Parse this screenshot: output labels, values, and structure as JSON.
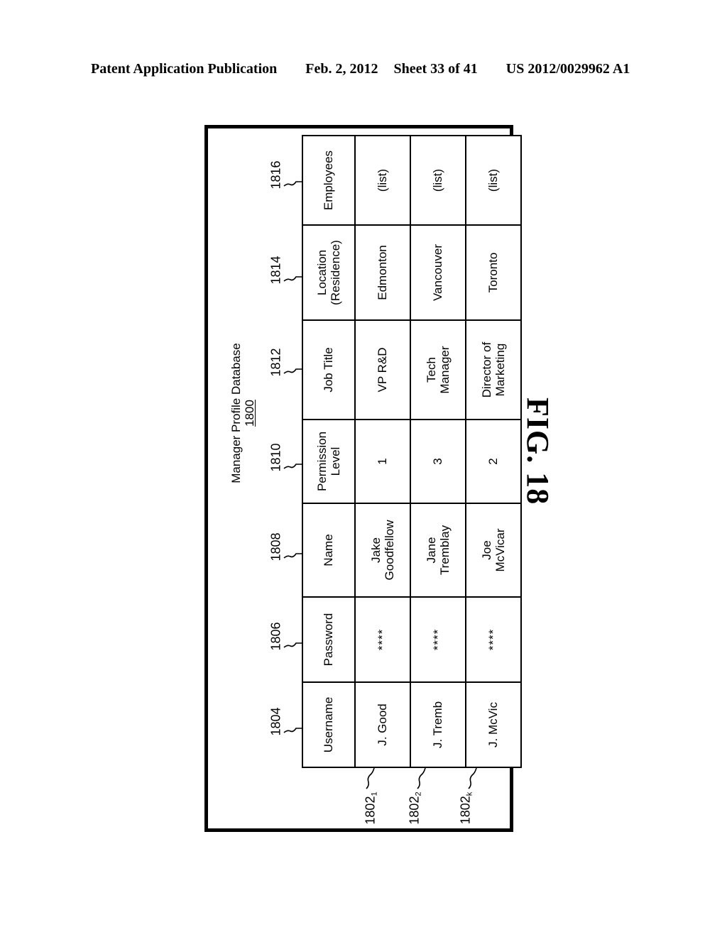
{
  "header": {
    "publication": "Patent Application Publication",
    "date": "Feb. 2, 2012",
    "sheet": "Sheet 33 of 41",
    "patent_number": "US 2012/0029962 A1"
  },
  "figure": {
    "label": "FIG. 18",
    "title": "Manager Profile Database",
    "title_ref": "1800"
  },
  "table": {
    "columns": [
      {
        "label": "Username",
        "ref": "1804"
      },
      {
        "label": "Password",
        "ref": "1806"
      },
      {
        "label": "Name",
        "ref": "1808"
      },
      {
        "label": "Permission\nLevel",
        "ref": "1810"
      },
      {
        "label": "Job Title",
        "ref": "1812"
      },
      {
        "label": "Location\n(Residence)",
        "ref": "1814"
      },
      {
        "label": "Employees",
        "ref": "1816"
      }
    ],
    "rows": [
      {
        "ref": "1802",
        "ref_sub": "1",
        "username": "J. Good",
        "password": "****",
        "name": "Jake\nGoodfellow",
        "permission_level": "1",
        "job_title": "VP R&D",
        "location": "Edmonton",
        "employees": "(list)"
      },
      {
        "ref": "1802",
        "ref_sub": "2",
        "username": "J. Tremb",
        "password": "****",
        "name": "Jane\nTremblay",
        "permission_level": "3",
        "job_title": "Tech\nManager",
        "location": "Vancouver",
        "employees": "(list)"
      },
      {
        "ref": "1802",
        "ref_sub": "k",
        "username": "J. McVic",
        "password": "****",
        "name": "Joe\nMcVicar",
        "permission_level": "2",
        "job_title": "Director of\nMarketing",
        "location": "Toronto",
        "employees": "(list)"
      }
    ]
  }
}
